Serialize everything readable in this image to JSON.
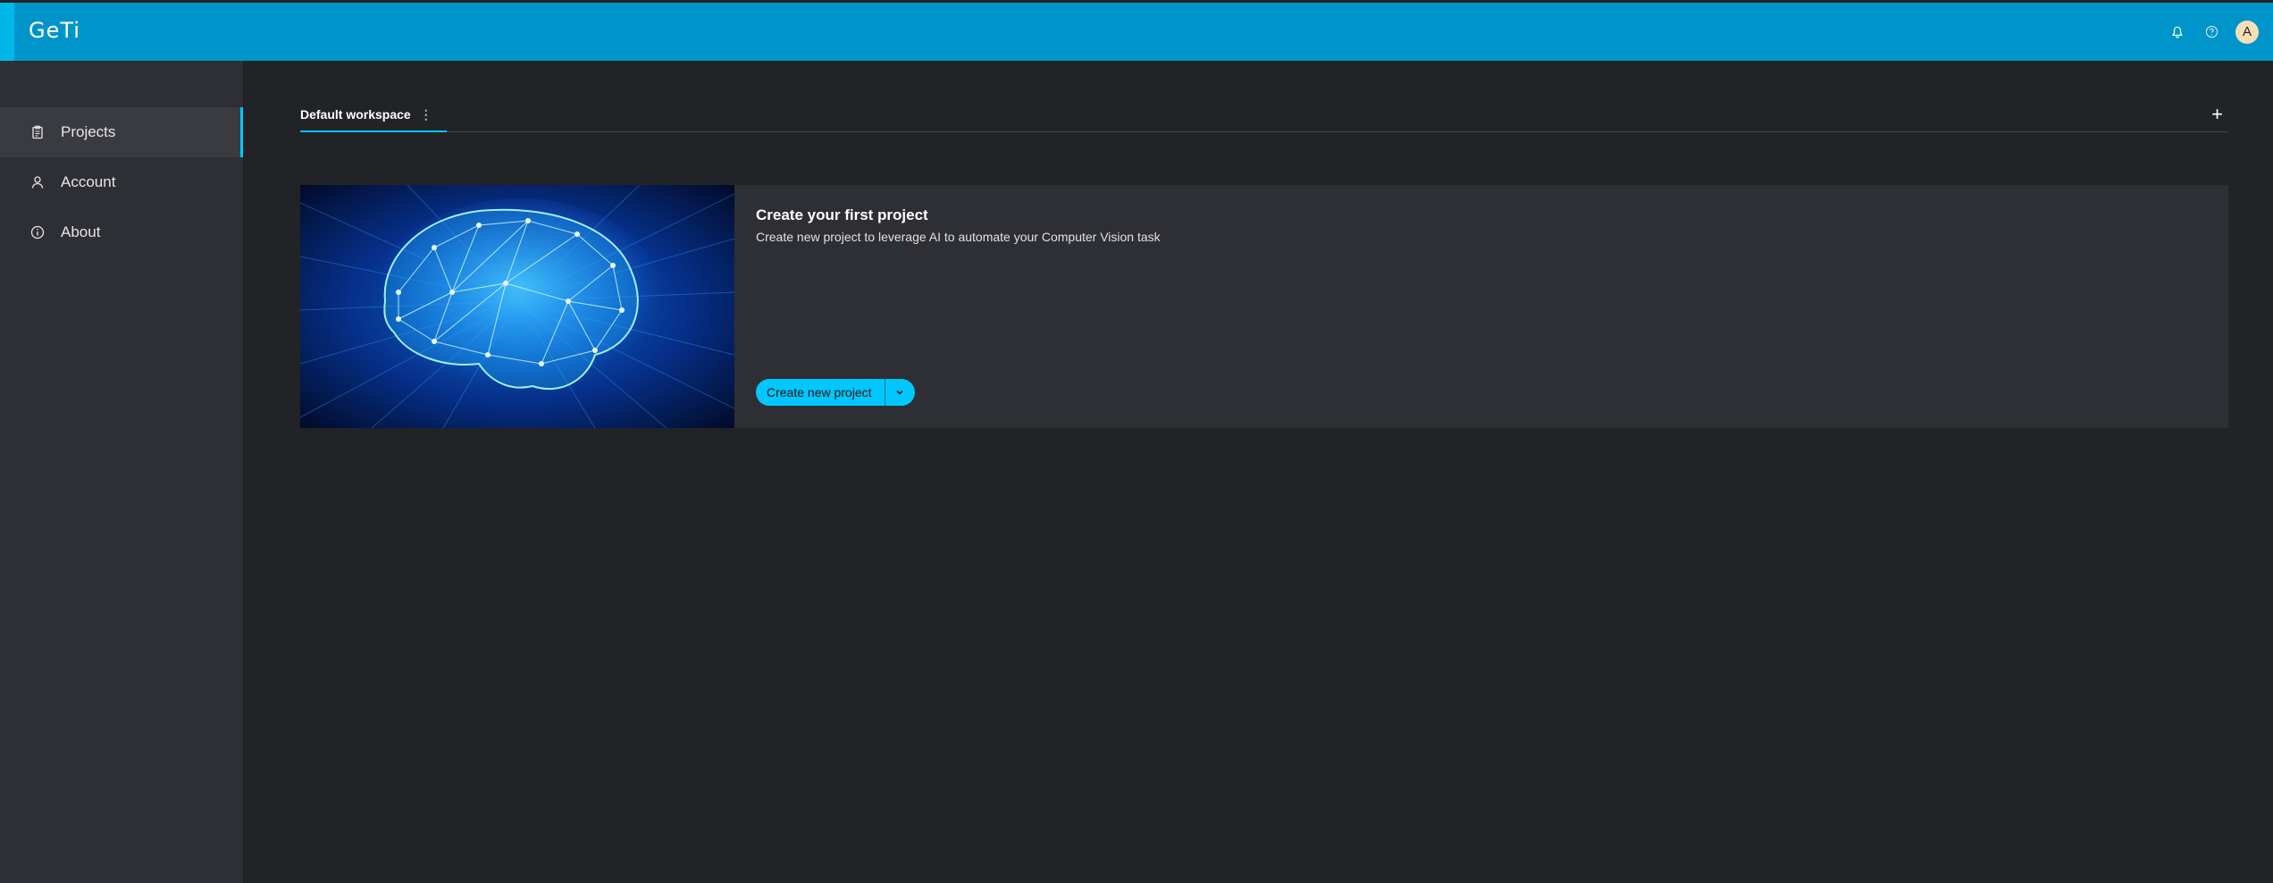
{
  "app": {
    "logo_text": "GeTi"
  },
  "header": {
    "icons": [
      "bell-icon",
      "help-icon"
    ],
    "avatar_initial": "A"
  },
  "sidebar": {
    "items": [
      {
        "label": "Projects",
        "icon": "clipboard-icon",
        "active": true
      },
      {
        "label": "Account",
        "icon": "user-icon",
        "active": false
      },
      {
        "label": "About",
        "icon": "info-icon",
        "active": false
      }
    ]
  },
  "workspace": {
    "tabs": [
      {
        "label": "Default workspace"
      }
    ],
    "add_icon": "plus-icon"
  },
  "card": {
    "title": "Create your first project",
    "description": "Create new project to leverage AI to automate your Computer Vision task",
    "button_label": "Create new project",
    "image": "brain-illustration"
  },
  "colors": {
    "header_bg": "#0095ca",
    "accent": "#00c7fd",
    "sidebar_bg": "#2e2f34",
    "page_bg": "#222327"
  }
}
